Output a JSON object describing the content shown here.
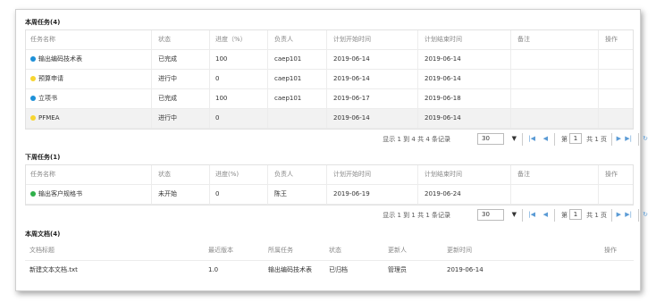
{
  "sec1": {
    "title": "本周任务(4)",
    "headers": [
      "任务名称",
      "状态",
      "进度（%）",
      "负责人",
      "计划开始时间",
      "计划结束时间",
      "备注",
      "操作"
    ],
    "rows": [
      {
        "name": "输出编码技术表",
        "status": "已完成",
        "progress": "100",
        "owner": "caep101",
        "start": "2019-06-14",
        "end": "2019-06-14",
        "dot": "#1e90d8"
      },
      {
        "name": "预算申请",
        "status": "进行中",
        "progress": "0",
        "owner": "caep101",
        "start": "2019-06-14",
        "end": "2019-06-14",
        "dot": "#f7d531"
      },
      {
        "name": "立项书",
        "status": "已完成",
        "progress": "100",
        "owner": "caep101",
        "start": "2019-06-17",
        "end": "2019-06-18",
        "dot": "#1e90d8"
      },
      {
        "name": "PFMEA",
        "status": "进行中",
        "progress": "0",
        "owner": "",
        "start": "2019-06-14",
        "end": "2019-06-14",
        "dot": "#f7d531"
      }
    ],
    "pager": {
      "info": "显示 1 到 4 共 4 条记录",
      "size": "30",
      "page_label": "第",
      "page": "1",
      "total": "共 1 页"
    }
  },
  "sec2": {
    "title": "下周任务(1)",
    "headers": [
      "任务名称",
      "状态",
      "进度(%)",
      "负责人",
      "计划开始时间",
      "计划结束时间",
      "备注",
      "操作"
    ],
    "rows": [
      {
        "name": "输出客户规格书",
        "status": "未开始",
        "progress": "0",
        "owner": "陈王",
        "start": "2019-06-19",
        "end": "2019-06-24",
        "dot": "#2fb04a"
      }
    ],
    "pager": {
      "info": "显示 1 到 1 共 1 条记录",
      "size": "30",
      "page_label": "第",
      "page": "1",
      "total": "共 1 页"
    }
  },
  "sec3": {
    "title": "本周文档(4)",
    "headers": [
      "文档标题",
      "最近版本",
      "所属任务",
      "状态",
      "更新人",
      "更新时间",
      "操作"
    ],
    "rows": [
      {
        "title": "新建文本文档.txt",
        "version": "1.0",
        "task": "输出编码技术表",
        "status": "已归档",
        "updater": "管理员",
        "time": "2019-06-14"
      }
    ]
  },
  "colors": {
    "blue": "#1e90d8",
    "yellow": "#f7d531",
    "green": "#2fb04a",
    "accent": "#5b9bd5"
  }
}
